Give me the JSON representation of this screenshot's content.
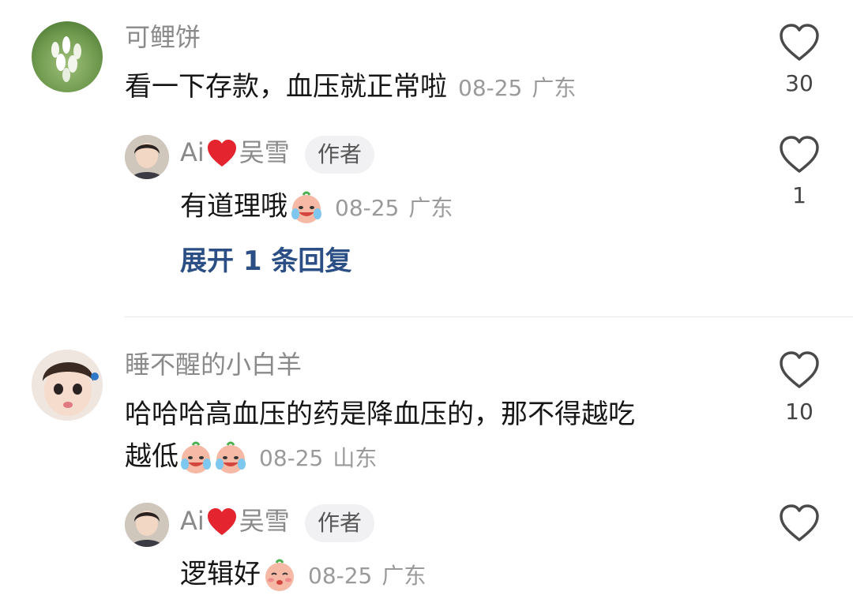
{
  "comments": [
    {
      "user": "可鲤饼",
      "text": "看一下存款，血压就正常啦",
      "date": "08-25",
      "location": "广东",
      "likes": "30",
      "reply": {
        "user_prefix": "Ai",
        "user_suffix": "吴雪",
        "badge": "作者",
        "text": "有道理哦",
        "date": "08-25",
        "location": "广东",
        "likes": "1"
      },
      "expand_label": "展开 1 条回复"
    },
    {
      "user": "睡不醒的小白羊",
      "text_line1": "哈哈哈高血压的药是降血压的，那不得越吃",
      "text_line2": "越低",
      "date": "08-25",
      "location": "山东",
      "likes": "10",
      "reply": {
        "user_prefix": "Ai",
        "user_suffix": "吴雪",
        "badge": "作者",
        "text": "逻辑好",
        "date": "08-25",
        "location": "广东",
        "likes": ""
      }
    }
  ]
}
